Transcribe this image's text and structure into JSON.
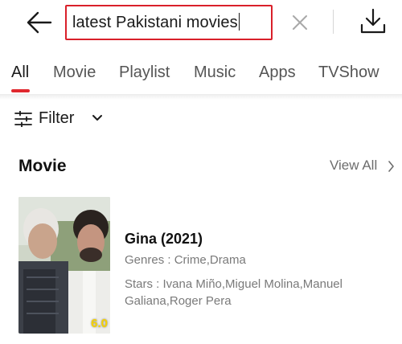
{
  "search": {
    "query": "latest Pakistani movies"
  },
  "tabs": [
    {
      "label": "All"
    },
    {
      "label": "Movie"
    },
    {
      "label": "Playlist"
    },
    {
      "label": "Music"
    },
    {
      "label": "Apps"
    },
    {
      "label": "TVShow"
    }
  ],
  "active_tab": "All",
  "filter": {
    "label": "Filter"
  },
  "section": {
    "title": "Movie",
    "view_all_label": "View All"
  },
  "movie": {
    "title": "Gina (2021)",
    "genres": "Genres : Crime,Drama",
    "stars": "Stars : Ivana Miño,Miguel Molina,Manuel Galiana,Roger Pera",
    "rating": "6.0"
  },
  "colors": {
    "accent": "#e0282e",
    "search_border": "#d9202a",
    "rating": "#f5d100",
    "muted_text": "#7a7a7a"
  },
  "icons": {
    "back": "arrow-left-icon",
    "clear": "close-icon",
    "download": "download-icon",
    "filter": "sliders-icon",
    "filter_chevron": "chevron-down-icon",
    "view_all_chevron": "chevron-right-icon"
  }
}
